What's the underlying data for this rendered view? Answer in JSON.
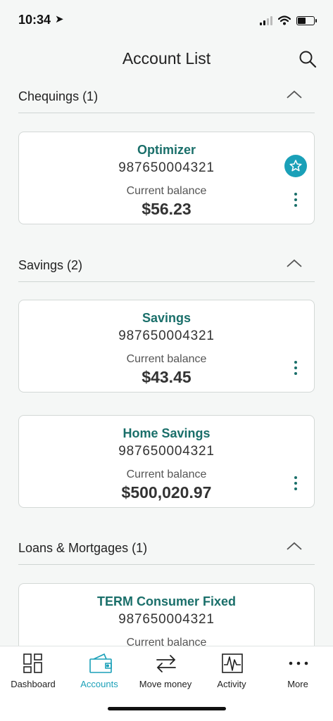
{
  "status": {
    "time": "10:34",
    "location_icon": "location-arrow-icon"
  },
  "header": {
    "title": "Account List",
    "search_icon": "search-icon"
  },
  "sections": [
    {
      "title": "Chequings (1)",
      "accounts": [
        {
          "name": "Optimizer",
          "number": "987650004321",
          "balance_label": "Current balance",
          "balance": "$56.23",
          "favorite": true
        }
      ]
    },
    {
      "title": "Savings (2)",
      "accounts": [
        {
          "name": "Savings",
          "number": "987650004321",
          "balance_label": "Current balance",
          "balance": "$43.45"
        },
        {
          "name": "Home Savings",
          "number": "987650004321",
          "balance_label": "Current balance",
          "balance": "$500,020.97"
        }
      ]
    },
    {
      "title": "Loans & Mortgages (1)",
      "accounts": [
        {
          "name": "TERM Consumer Fixed",
          "number": "987650004321",
          "balance_label": "Current balance"
        }
      ]
    }
  ],
  "tabs": [
    {
      "label": "Dashboard",
      "icon": "dashboard-icon"
    },
    {
      "label": "Accounts",
      "icon": "wallet-icon",
      "active": true
    },
    {
      "label": "Move money",
      "icon": "transfer-arrows-icon"
    },
    {
      "label": "Activity",
      "icon": "activity-chart-icon"
    },
    {
      "label": "More",
      "icon": "more-dots-icon"
    }
  ],
  "colors": {
    "accent": "#1aa0b8",
    "brand_text": "#1a6f6a"
  }
}
